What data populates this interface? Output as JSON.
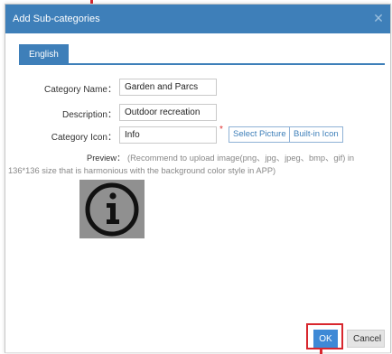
{
  "dialog": {
    "title": "Add Sub-categories",
    "close_symbol": "✕"
  },
  "tabs": [
    {
      "label": "English",
      "active": true
    }
  ],
  "form": {
    "category_name_label": "Category Name：",
    "category_name_value": "Garden and Parcs",
    "description_label": "Description：",
    "description_value": "Outdoor recreation",
    "category_icon_label": "Category Icon：",
    "category_icon_value": "Info",
    "required_marker": "*",
    "select_picture_label": "Select Picture",
    "builtin_icon_label": "Built-in Icon",
    "preview_label": "Preview：",
    "preview_hint": "(Recommend to upload image(png、jpg、jpeg、bmp、gif) in 136*136 size that is harmonious with the background color style in APP)"
  },
  "preview_icon": {
    "icon": "info-icon",
    "glyph": "i"
  },
  "footer": {
    "ok_label": "OK",
    "cancel_label": "Cancel"
  },
  "colors": {
    "accent": "#3e7fb9",
    "ok_button": "#3e89d6",
    "highlight": "#d8272e",
    "preview_background": "#909090"
  }
}
